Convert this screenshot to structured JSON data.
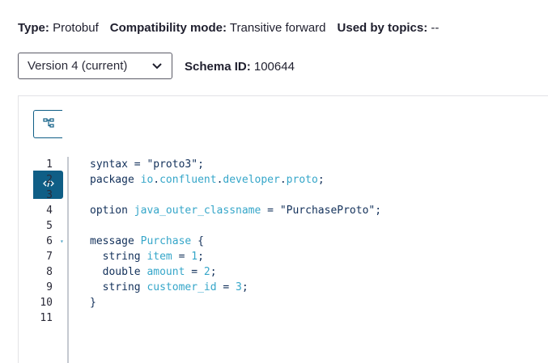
{
  "meta": {
    "type_label": "Type:",
    "type_value": "Protobuf",
    "compat_label": "Compatibility mode:",
    "compat_value": "Transitive forward",
    "topics_label": "Used by topics:",
    "topics_value": "--"
  },
  "version": {
    "selected": "Version 4 (current)"
  },
  "schema": {
    "id_label": "Schema ID:",
    "id_value": "100644"
  },
  "view_toggle": {
    "tree_icon": "tree-view-icon",
    "code_icon": "code-view-icon",
    "active": "code"
  },
  "colors": {
    "accent": "#0f5e86",
    "keyword": "#12305a",
    "identifier": "#35a6c9"
  },
  "code_lines": [
    {
      "n": "1",
      "tokens": [
        {
          "t": "syntax",
          "c": "kw"
        },
        {
          "t": " = ",
          "c": "punct"
        },
        {
          "t": "\"proto3\"",
          "c": "str"
        },
        {
          "t": ";",
          "c": "punct"
        }
      ]
    },
    {
      "n": "2",
      "tokens": [
        {
          "t": "package ",
          "c": "kw"
        },
        {
          "t": "io",
          "c": "ident"
        },
        {
          "t": ".",
          "c": "punct"
        },
        {
          "t": "confluent",
          "c": "ident"
        },
        {
          "t": ".",
          "c": "punct"
        },
        {
          "t": "developer",
          "c": "ident"
        },
        {
          "t": ".",
          "c": "punct"
        },
        {
          "t": "proto",
          "c": "ident"
        },
        {
          "t": ";",
          "c": "punct"
        }
      ]
    },
    {
      "n": "3",
      "tokens": []
    },
    {
      "n": "4",
      "tokens": [
        {
          "t": "option ",
          "c": "kw"
        },
        {
          "t": "java_outer_classname",
          "c": "ident"
        },
        {
          "t": " = ",
          "c": "punct"
        },
        {
          "t": "\"PurchaseProto\"",
          "c": "str"
        },
        {
          "t": ";",
          "c": "punct"
        }
      ]
    },
    {
      "n": "5",
      "tokens": []
    },
    {
      "n": "6",
      "fold": "▾",
      "tokens": [
        {
          "t": "message ",
          "c": "kw"
        },
        {
          "t": "Purchase",
          "c": "ident"
        },
        {
          "t": " {",
          "c": "punct"
        }
      ]
    },
    {
      "n": "7",
      "tokens": [
        {
          "t": "  string ",
          "c": "kw"
        },
        {
          "t": "item",
          "c": "ident"
        },
        {
          "t": " = ",
          "c": "punct"
        },
        {
          "t": "1",
          "c": "num"
        },
        {
          "t": ";",
          "c": "punct"
        }
      ]
    },
    {
      "n": "8",
      "tokens": [
        {
          "t": "  double ",
          "c": "kw"
        },
        {
          "t": "amount",
          "c": "ident"
        },
        {
          "t": " = ",
          "c": "punct"
        },
        {
          "t": "2",
          "c": "num"
        },
        {
          "t": ";",
          "c": "punct"
        }
      ]
    },
    {
      "n": "9",
      "tokens": [
        {
          "t": "  string ",
          "c": "kw"
        },
        {
          "t": "customer_id",
          "c": "ident"
        },
        {
          "t": " = ",
          "c": "punct"
        },
        {
          "t": "3",
          "c": "num"
        },
        {
          "t": ";",
          "c": "punct"
        }
      ]
    },
    {
      "n": "10",
      "tokens": [
        {
          "t": "}",
          "c": "punct"
        }
      ]
    },
    {
      "n": "11",
      "tokens": []
    }
  ]
}
